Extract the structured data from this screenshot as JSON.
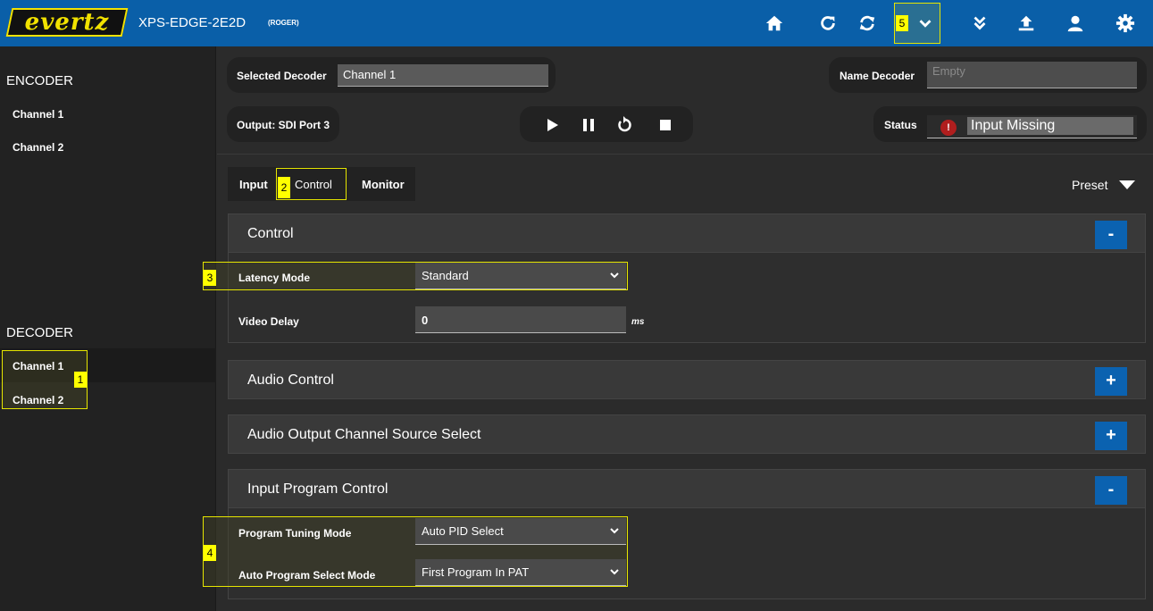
{
  "header": {
    "logo": "evertz",
    "device_name": "XPS-EDGE-2E2D",
    "device_sub": "(ROGER)",
    "icons": [
      "home-icon",
      "refresh-icon",
      "sync-icon",
      "chevron-down-icon",
      "double-chevron-down-icon",
      "upload-icon",
      "user-icon",
      "gear-icon"
    ],
    "badge_5": "5"
  },
  "sidebar": {
    "encoder_title": "ENCODER",
    "encoder_items": [
      "Channel 1",
      "Channel 2"
    ],
    "decoder_title": "DECODER",
    "decoder_items": [
      "Channel 1",
      "Channel 2"
    ],
    "badge_1": "1"
  },
  "top": {
    "selected_decoder_label": "Selected Decoder",
    "selected_decoder_value": "Channel 1",
    "name_decoder_label": "Name Decoder",
    "name_decoder_placeholder": "Empty",
    "output_label": "Output: SDI Port 3",
    "status_label": "Status",
    "status_value": "Input Missing",
    "status_icon_text": "!"
  },
  "tabs": {
    "items": [
      "Input",
      "Control",
      "Monitor"
    ],
    "badge_2": "2",
    "preset_label": "Preset"
  },
  "panels": {
    "control_title": "Control",
    "latency_label": "Latency Mode",
    "latency_value": "Standard",
    "badge_3": "3",
    "video_delay_label": "Video Delay",
    "video_delay_value": "0",
    "video_delay_unit": "ms",
    "audio_control_title": "Audio Control",
    "audio_output_title": "Audio Output Channel Source Select",
    "input_program_title": "Input Program Control",
    "tuning_label": "Program Tuning Mode",
    "tuning_value": "Auto PID Select",
    "auto_select_label": "Auto Program Select Mode",
    "auto_select_value": "First Program In PAT",
    "badge_4": "4",
    "minus": "-",
    "plus": "+"
  },
  "colors": {
    "header_blue": "#0a5fa8",
    "button_blue": "#0b62b0",
    "highlight_yellow": "#ffff00",
    "status_red": "#b01e1e"
  }
}
